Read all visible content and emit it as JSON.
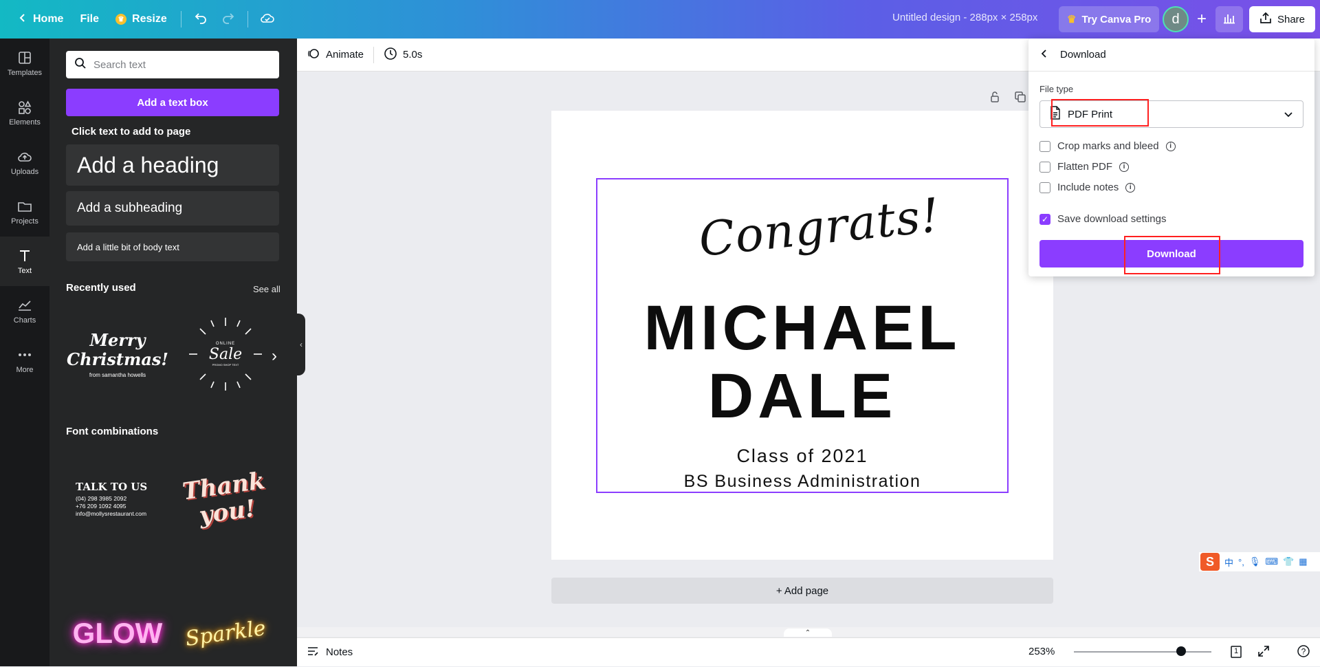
{
  "topbar": {
    "home": "Home",
    "file": "File",
    "resize": "Resize",
    "doc_title": "Untitled design - 288px × 258px",
    "try_pro": "Try Canva Pro",
    "avatar_initial": "d",
    "share": "Share"
  },
  "rail": {
    "items": [
      {
        "label": "Templates"
      },
      {
        "label": "Elements"
      },
      {
        "label": "Uploads"
      },
      {
        "label": "Projects"
      },
      {
        "label": "Text"
      },
      {
        "label": "Charts"
      },
      {
        "label": "More"
      }
    ],
    "active": "Text"
  },
  "panel": {
    "search_placeholder": "Search text",
    "add_textbox": "Add a text box",
    "click_hint": "Click text to add to page",
    "add_heading": "Add a heading",
    "add_subheading": "Add a subheading",
    "add_body": "Add a little bit of body text",
    "recently_used": "Recently used",
    "see_all": "See all",
    "recent": {
      "merry_1": "Merry",
      "merry_2": "Christmas!",
      "merry_from": "from samantha howells",
      "sale_top": "ONLINE",
      "sale_main": "Sale",
      "sale_sub": "PROMO SHOP TEXT"
    },
    "font_combinations": "Font combinations",
    "combos": {
      "talk_title": "TALK TO US",
      "talk_lines": [
        "(04) 298 3985 2092",
        "+76 209 1092 4095",
        "info@mollysrestaurant.com"
      ],
      "thank_1": "Thank",
      "thank_2": "you!",
      "glow": "GLOW",
      "sparkle": "Sparkle"
    }
  },
  "toolbar": {
    "animate": "Animate",
    "duration": "5.0s"
  },
  "canvas": {
    "congrats": "Congrats!",
    "name_line1": "MICHAEL",
    "name_line2": "DALE",
    "class_line": "Class of 2021",
    "major_line": "BS Business Administration",
    "add_page": "+ Add page"
  },
  "footer": {
    "notes": "Notes",
    "zoom": "253%",
    "page_count": "1",
    "zoom_fraction": 0.78
  },
  "download": {
    "title": "Download",
    "file_type_label": "File type",
    "file_type_value": "PDF Print",
    "options": [
      {
        "label": "Crop marks and bleed",
        "checked": false
      },
      {
        "label": "Flatten PDF",
        "checked": false
      },
      {
        "label": "Include notes",
        "checked": false
      }
    ],
    "save_settings": {
      "label": "Save download settings",
      "checked": true
    },
    "button": "Download"
  },
  "ime": {
    "brand": "S",
    "zh": "中"
  },
  "colors": {
    "accent": "#8b3dff",
    "highlight": "#ff1f1f",
    "rail_bg": "#18191b",
    "panel_bg": "#252627"
  }
}
